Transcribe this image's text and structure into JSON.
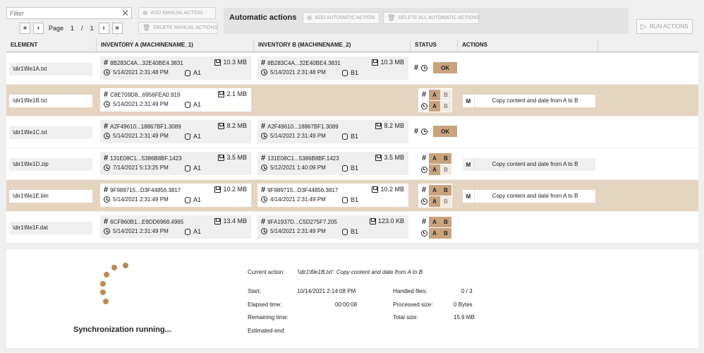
{
  "toolbar": {
    "filter_placeholder": "Filter",
    "page_label": "Page",
    "page_current": "1",
    "page_sep": "/",
    "page_total": "1",
    "add_manual_action": "ADD MANUAL ACTION",
    "delete_manual_actions": "DELETE MANUAL ACTIONS",
    "automatic_actions_title": "Automatic actions",
    "add_automatic_action": "ADD AUTOMATIC ACTION",
    "delete_all_automatic_actions": "DELETE ALL AUTOMATIC ACTIONS",
    "run_actions": "RUN ACTIONS"
  },
  "columns": [
    "ELEMENT",
    "INVENTORY A (MACHINENAME_1)",
    "INVENTORY B (MACHINENAME_2)",
    "STATUS",
    "ACTIONS"
  ],
  "rows": [
    {
      "element": "\\dir1\\file1A.txt",
      "a": {
        "hash": "8B283C4A...32E40BE4.3831",
        "size": "10.3 MB",
        "date": "5/14/2021 2:31:48 PM",
        "disk": "A1"
      },
      "b": {
        "hash": "8B283C4A...32E40BE4.3831",
        "size": "10.3 MB",
        "date": "5/14/2021 2:31:48 PM",
        "disk": "B1"
      },
      "status": "OK"
    },
    {
      "element": "\\dir1\\file1B.txt",
      "a": {
        "hash": "C8E709D8...6956FEA0.919",
        "size": "2.1 MB",
        "date": "5/14/2021 2:31:49 PM",
        "disk": "A1"
      },
      "status_cells": {
        "hash": [
          "A",
          "B"
        ],
        "date": [
          "A",
          "B"
        ]
      },
      "action": {
        "mode": "M",
        "text": "Copy content and date from A to B"
      }
    },
    {
      "element": "\\dir1\\file1C.txt",
      "a": {
        "hash": "A2F49610...18867BF1.3089",
        "size": "8.2 MB",
        "date": "5/14/2021 2:31:49 PM",
        "disk": "A1"
      },
      "b": {
        "hash": "A2F49610...18867BF1.3089",
        "size": "8.2 MB",
        "date": "5/14/2021 2:31:49 PM",
        "disk": "B1"
      },
      "status": "OK"
    },
    {
      "element": "\\dir1\\file1D.zip",
      "a": {
        "hash": "131E08C1...5386B8BF.1423",
        "size": "3.5 MB",
        "date": "7/14/2021 5:13:25 PM",
        "disk": "A1"
      },
      "b": {
        "hash": "131E08C1...5386B8BF.1423",
        "size": "3.5 MB",
        "date": "5/12/2021 1:40:09 PM",
        "disk": "B1"
      },
      "status_cells": {
        "hash": [
          "A",
          "B"
        ],
        "date": [
          "A",
          "B"
        ]
      },
      "action": {
        "mode": "M",
        "text": "Copy content and date from A to B"
      }
    },
    {
      "element": "\\dir1\\file1E.bin",
      "a": {
        "hash": "9F989715...D3F44856.3817",
        "size": "10.2 MB",
        "date": "5/14/2021 2:31:49 PM",
        "disk": "A1"
      },
      "b": {
        "hash": "9F989715...D3F44856.3817",
        "size": "10.2 MB",
        "date": "4/14/2021 2:31:49 PM",
        "disk": "B1"
      },
      "status_cells": {
        "hash": [
          "A",
          "B"
        ],
        "date": [
          "A",
          "B"
        ]
      },
      "action": {
        "mode": "M",
        "text": "Copy content and date from A to B"
      }
    },
    {
      "element": "\\dir1\\file1F.dat",
      "a": {
        "hash": "6CF860B1...E9DD6968.4965",
        "size": "13.4 MB",
        "date": "5/14/2021 2:31:49 PM",
        "disk": "A1"
      },
      "b": {
        "hash": "9FA1937D...C5D275F7.205",
        "size": "123.0 KB",
        "date": "5/14/2021 2:31:49 PM",
        "disk": "B1"
      },
      "status_cells": {
        "hash": [
          "A",
          "B"
        ],
        "date": [
          "A",
          "B"
        ]
      }
    }
  ],
  "sync": {
    "running_label": "Synchronization running...",
    "current_action_label": "Current action:",
    "current_action_value": "'\\dir1\\file1B.txt': Copy content and date from A to B",
    "start_label": "Start:",
    "start_value": "10/14/2021 2:14:08 PM",
    "elapsed_label": "Elapsed time:",
    "elapsed_value": "00:00:08",
    "remaining_label": "Remaining time:",
    "estimated_label": "Estimated end:",
    "handled_label": "Handled files:",
    "handled_value": "0 / 3",
    "processed_label": "Processed size:",
    "processed_value": "0 Bytes",
    "total_label": "Total size:",
    "total_value": "15.9 MB"
  },
  "colors": {
    "accent": "#c8a37e",
    "selected_row": "#e5d4bf",
    "spinner": "#b88a55"
  }
}
